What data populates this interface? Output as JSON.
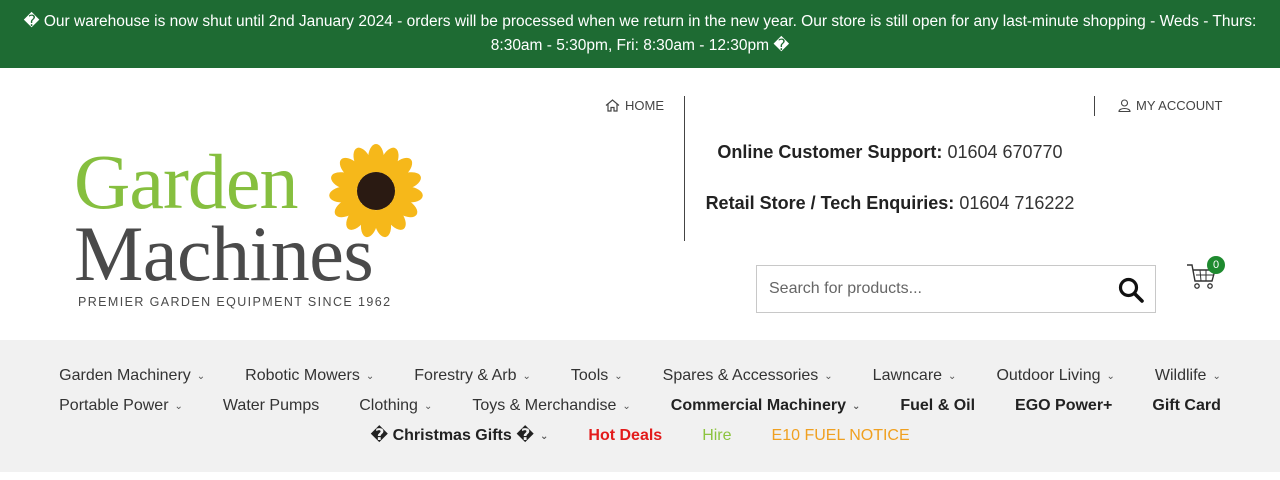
{
  "banner": {
    "text": "� Our warehouse is now shut until 2nd January 2024 - orders will be processed when we return in the new year. Our store is still open for any last-minute shopping - Weds - Thurs: 8:30am - 5:30pm, Fri: 8:30am - 12:30pm �"
  },
  "logo": {
    "line1": "Garden",
    "line2": "Machines",
    "tagline": "PREMIER GARDEN EQUIPMENT SINCE 1962"
  },
  "top_links": {
    "home": "HOME",
    "account": "MY ACCOUNT"
  },
  "support": {
    "online_label": "Online Customer Support:",
    "online_phone": "01604 670770",
    "retail_label": "Retail Store / Tech Enquiries:",
    "retail_phone": "01604 716222"
  },
  "search": {
    "placeholder": "Search for products..."
  },
  "cart": {
    "count": "0"
  },
  "nav": {
    "row1": [
      {
        "label": "Garden Machinery"
      },
      {
        "label": "Robotic Mowers"
      },
      {
        "label": "Forestry & Arb"
      },
      {
        "label": "Tools"
      },
      {
        "label": "Spares & Accessories"
      },
      {
        "label": "Lawncare"
      },
      {
        "label": "Outdoor Living"
      },
      {
        "label": "Wildlife"
      }
    ],
    "row2": [
      {
        "label": "Portable Power"
      },
      {
        "label": "Water Pumps"
      },
      {
        "label": "Clothing"
      },
      {
        "label": "Toys & Merchandise"
      },
      {
        "label": "Commercial Machinery"
      },
      {
        "label": "Fuel & Oil"
      },
      {
        "label": "EGO Power+"
      },
      {
        "label": "Gift Card"
      }
    ],
    "row3": [
      {
        "label": "� Christmas Gifts �"
      },
      {
        "label": "Hot Deals"
      },
      {
        "label": "Hire"
      },
      {
        "label": "E10 FUEL NOTICE"
      }
    ]
  },
  "colors": {
    "banner_bg": "#1e6b33",
    "logo_green": "#86bf3f",
    "logo_grey": "#4a4a4a",
    "hot_deals": "#e31b1b",
    "hire": "#8cc43f",
    "e10_notice": "#f0a020",
    "cart_badge": "#1e8a2f"
  }
}
